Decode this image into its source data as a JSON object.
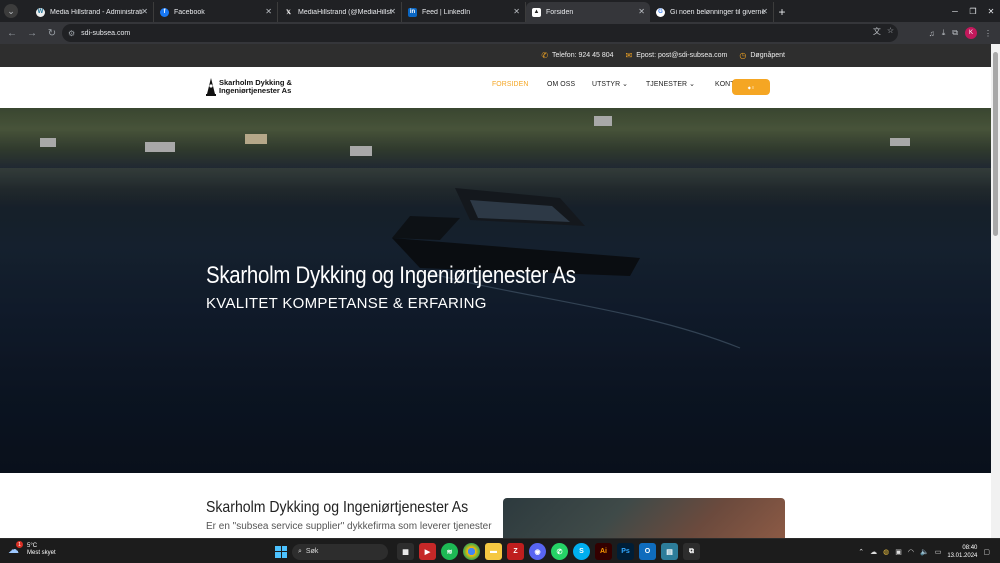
{
  "browser": {
    "tabs": [
      {
        "title": "Media Hillstrand - Administrati",
        "icon": "wordpress-icon",
        "active": false
      },
      {
        "title": "Facebook",
        "icon": "facebook-icon",
        "active": false
      },
      {
        "title": "MediaHillstrand (@MediaHillst",
        "icon": "x-icon",
        "active": false
      },
      {
        "title": "Feed | LinkedIn",
        "icon": "linkedin-icon",
        "active": false
      },
      {
        "title": "Forsiden",
        "icon": "site-icon",
        "active": true
      },
      {
        "title": "Gi noen belønninger til giverne",
        "icon": "google-icon",
        "active": false
      }
    ],
    "url": "sdi-subsea.com",
    "profile_initial": "K"
  },
  "site": {
    "topbar": {
      "phone": "Telefon: 924 45 804",
      "email": "Epost: post@sdi-subsea.com",
      "hours": "Døgnåpent"
    },
    "logo": {
      "line1": "Skarholm Dykking &",
      "line2": "Ingeniørtjenester As"
    },
    "menu": [
      {
        "label": "FORSIDEN",
        "active": true,
        "dropdown": false
      },
      {
        "label": "OM OSS",
        "active": false,
        "dropdown": false
      },
      {
        "label": "UTSTYR",
        "active": false,
        "dropdown": true
      },
      {
        "label": "TJENESTER",
        "active": false,
        "dropdown": true
      },
      {
        "label": "KONTAKT OSS",
        "active": false,
        "dropdown": false
      }
    ],
    "accent": "#f5a623",
    "hero": {
      "title": "Skarholm Dykking og Ingeniørtjenester As",
      "subtitle": "KVALITET KOMPETANSE & ERFARING"
    },
    "intro": {
      "heading": "Skarholm Dykking og Ingeniørtjenester As",
      "text": "Er en \"subsea service supplier\" dykkefirma som leverer tjenester"
    }
  },
  "taskbar": {
    "weather_temp": "5°C",
    "weather_desc": "Mest skyet",
    "weather_badge": "1",
    "search_label": "Søk",
    "time": "08:40",
    "date": "13.01.2024"
  }
}
